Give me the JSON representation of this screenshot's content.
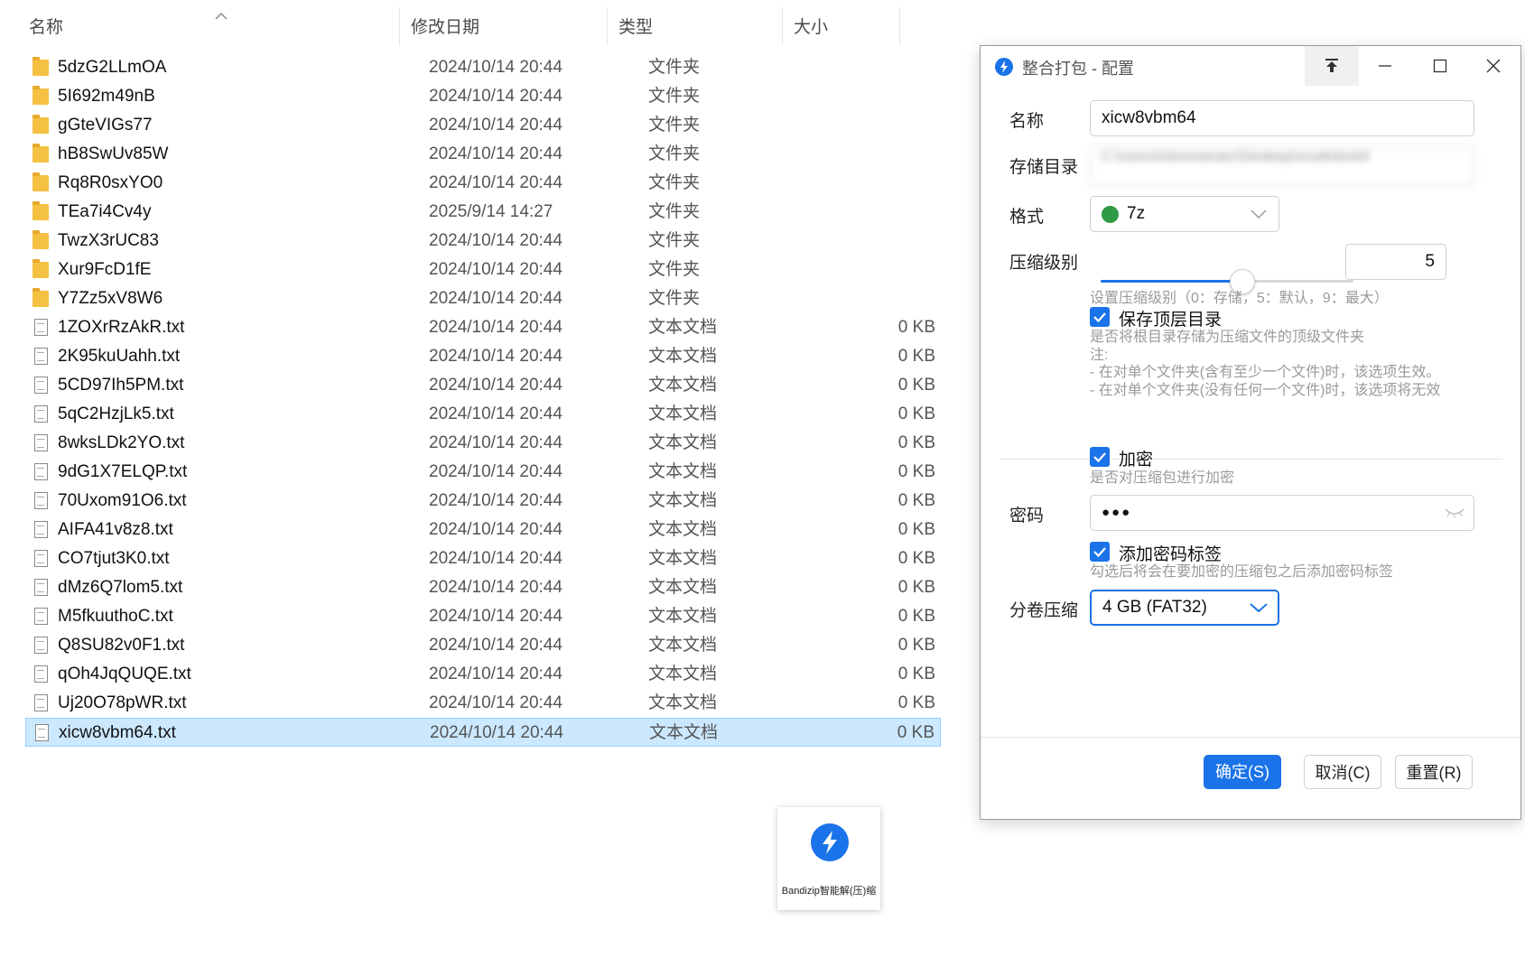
{
  "explorer": {
    "columns": {
      "name": "名称",
      "date": "修改日期",
      "type": "类型",
      "size": "大小"
    },
    "rows": [
      {
        "name": "5dzG2LLmOA",
        "date": "2024/10/14 20:44",
        "type": "文件夹",
        "size": "",
        "kind": "folder"
      },
      {
        "name": "5I692m49nB",
        "date": "2024/10/14 20:44",
        "type": "文件夹",
        "size": "",
        "kind": "folder"
      },
      {
        "name": "gGteVIGs77",
        "date": "2024/10/14 20:44",
        "type": "文件夹",
        "size": "",
        "kind": "folder"
      },
      {
        "name": "hB8SwUv85W",
        "date": "2024/10/14 20:44",
        "type": "文件夹",
        "size": "",
        "kind": "folder"
      },
      {
        "name": "Rq8R0sxYO0",
        "date": "2024/10/14 20:44",
        "type": "文件夹",
        "size": "",
        "kind": "folder"
      },
      {
        "name": "TEa7i4Cv4y",
        "date": "2025/9/14 14:27",
        "type": "文件夹",
        "size": "",
        "kind": "folder"
      },
      {
        "name": "TwzX3rUC83",
        "date": "2024/10/14 20:44",
        "type": "文件夹",
        "size": "",
        "kind": "folder"
      },
      {
        "name": "Xur9FcD1fE",
        "date": "2024/10/14 20:44",
        "type": "文件夹",
        "size": "",
        "kind": "folder"
      },
      {
        "name": "Y7Zz5xV8W6",
        "date": "2024/10/14 20:44",
        "type": "文件夹",
        "size": "",
        "kind": "folder"
      },
      {
        "name": "1ZOXrRzAkR.txt",
        "date": "2024/10/14 20:44",
        "type": "文本文档",
        "size": "0 KB",
        "kind": "file"
      },
      {
        "name": "2K95kuUahh.txt",
        "date": "2024/10/14 20:44",
        "type": "文本文档",
        "size": "0 KB",
        "kind": "file"
      },
      {
        "name": "5CD97Ih5PM.txt",
        "date": "2024/10/14 20:44",
        "type": "文本文档",
        "size": "0 KB",
        "kind": "file"
      },
      {
        "name": "5qC2HzjLk5.txt",
        "date": "2024/10/14 20:44",
        "type": "文本文档",
        "size": "0 KB",
        "kind": "file"
      },
      {
        "name": "8wksLDk2YO.txt",
        "date": "2024/10/14 20:44",
        "type": "文本文档",
        "size": "0 KB",
        "kind": "file"
      },
      {
        "name": "9dG1X7ELQP.txt",
        "date": "2024/10/14 20:44",
        "type": "文本文档",
        "size": "0 KB",
        "kind": "file"
      },
      {
        "name": "70Uxom91O6.txt",
        "date": "2024/10/14 20:44",
        "type": "文本文档",
        "size": "0 KB",
        "kind": "file"
      },
      {
        "name": "AIFA41v8z8.txt",
        "date": "2024/10/14 20:44",
        "type": "文本文档",
        "size": "0 KB",
        "kind": "file"
      },
      {
        "name": "CO7tjut3K0.txt",
        "date": "2024/10/14 20:44",
        "type": "文本文档",
        "size": "0 KB",
        "kind": "file"
      },
      {
        "name": "dMz6Q7lom5.txt",
        "date": "2024/10/14 20:44",
        "type": "文本文档",
        "size": "0 KB",
        "kind": "file"
      },
      {
        "name": "M5fkuuthoC.txt",
        "date": "2024/10/14 20:44",
        "type": "文本文档",
        "size": "0 KB",
        "kind": "file"
      },
      {
        "name": "Q8SU82v0F1.txt",
        "date": "2024/10/14 20:44",
        "type": "文本文档",
        "size": "0 KB",
        "kind": "file"
      },
      {
        "name": "qOh4JqQUQE.txt",
        "date": "2024/10/14 20:44",
        "type": "文本文档",
        "size": "0 KB",
        "kind": "file"
      },
      {
        "name": "Uj20O78pWR.txt",
        "date": "2024/10/14 20:44",
        "type": "文本文档",
        "size": "0 KB",
        "kind": "file"
      },
      {
        "name": "xicw8vbm64.txt",
        "date": "2024/10/14 20:44",
        "type": "文本文档",
        "size": "0 KB",
        "kind": "file",
        "selected": true
      }
    ]
  },
  "dialog": {
    "title": "整合打包 - 配置",
    "name_label": "名称",
    "name_value": "xicw8vbm64",
    "dir_label": "存储目录",
    "dir_value": "C:\\Users\\Administrator\\Desktop\\xicw8vbm64",
    "format_label": "格式",
    "format_value": "7z",
    "level_label": "压缩级别",
    "level_value": "5",
    "level_fraction": 0.5556,
    "level_hint": "设置压缩级别（0：存储，5：默认，9：最大）",
    "keep_top_label": "保存顶层目录",
    "keep_top_hint_1": "是否将根目录存储为压缩文件的顶级文件夹",
    "keep_top_hint_2": "注:",
    "keep_top_hint_3": " - 在对单个文件夹(含有至少一个文件)时，该选项生效。",
    "keep_top_hint_4": " - 在对单个文件夹(没有任何一个文件)时，该选项将无效",
    "encrypt_label": "加密",
    "encrypt_hint": "是否对压缩包进行加密",
    "password_label": "密码",
    "password_value": "●●●",
    "pwd_tag_label": "添加密码标签",
    "pwd_tag_hint": "勾选后将会在要加密的压缩包之后添加密码标签",
    "split_label": "分卷压缩",
    "split_value": "4 GB (FAT32)",
    "ok_label": "确定(S)",
    "cancel_label": "取消(C)",
    "reset_label": "重置(R)",
    "accent_color": "#1a73e8"
  },
  "drag_tip": {
    "caption": "Bandizip智能解(压)缩"
  }
}
